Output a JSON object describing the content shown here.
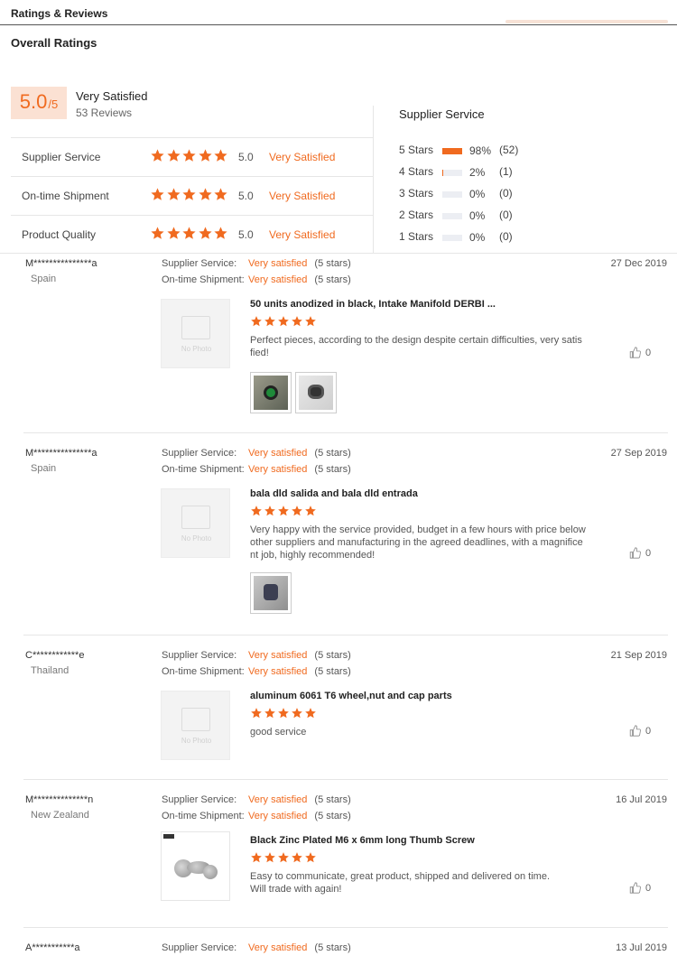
{
  "header": {
    "title": "Ratings & Reviews"
  },
  "overall": {
    "title": "Overall Ratings",
    "score": "5.0",
    "score_max": "/5",
    "label": "Very Satisfied",
    "reviews_count": "53 Reviews",
    "categories": [
      {
        "name": "Supplier Service",
        "stars": 5,
        "score": "5.0",
        "label": "Very Satisfied"
      },
      {
        "name": "On-time Shipment",
        "stars": 5,
        "score": "5.0",
        "label": "Very Satisfied"
      },
      {
        "name": "Product Quality",
        "stars": 5,
        "score": "5.0",
        "label": "Very Satisfied"
      }
    ]
  },
  "breakdown": {
    "title": "Supplier Service",
    "rows": [
      {
        "label": "5 Stars",
        "percent": "98%",
        "count": "(52)",
        "fill": 0.98
      },
      {
        "label": "4 Stars",
        "percent": "2%",
        "count": "(1)",
        "fill": 0.02
      },
      {
        "label": "3 Stars",
        "percent": "0%",
        "count": "(0)",
        "fill": 0
      },
      {
        "label": "2 Stars",
        "percent": "0%",
        "count": "(0)",
        "fill": 0
      },
      {
        "label": "1 Stars",
        "percent": "0%",
        "count": "(0)",
        "fill": 0
      }
    ]
  },
  "review_labels": {
    "supplier_service": "Supplier Service:",
    "on_time_shipment": "On-time Shipment:",
    "very_satisfied": "Very satisfied",
    "five_stars": "(5 stars)",
    "no_photo": "No Photo"
  },
  "reviews": [
    {
      "user": "M***************a",
      "country": "Spain",
      "date": "27 Dec 2019",
      "product": "50 units anodized in black, Intake Manifold DERBI ...",
      "comment": "Perfect pieces, according to the design despite certain difficulties, very satis fied!",
      "likes": "0"
    },
    {
      "user": "M***************a",
      "country": "Spain",
      "date": "27 Sep 2019",
      "product": "bala dld salida and bala dld entrada",
      "comment": "Very happy with the service provided, budget in a few hours with price below other suppliers and manufacturing in the agreed deadlines, with a magnifice nt job, highly recommended!",
      "likes": "0"
    },
    {
      "user": "C************e",
      "country": "Thailand",
      "date": "21 Sep 2019",
      "product": "aluminum 6061 T6 wheel,nut and cap parts",
      "comment": "good service",
      "likes": "0"
    },
    {
      "user": "M**************n",
      "country": "New Zealand",
      "date": "16 Jul 2019",
      "product": "Black Zinc Plated M6 x 6mm long Thumb Screw",
      "comment": "Easy to communicate, great product, shipped and delivered on time. Will trade with again!",
      "likes": "0"
    },
    {
      "user": "A***********a",
      "date": "13 Jul 2019"
    }
  ],
  "colors": {
    "accent": "#f06a1f",
    "score_bg": "#fbe1d3"
  }
}
